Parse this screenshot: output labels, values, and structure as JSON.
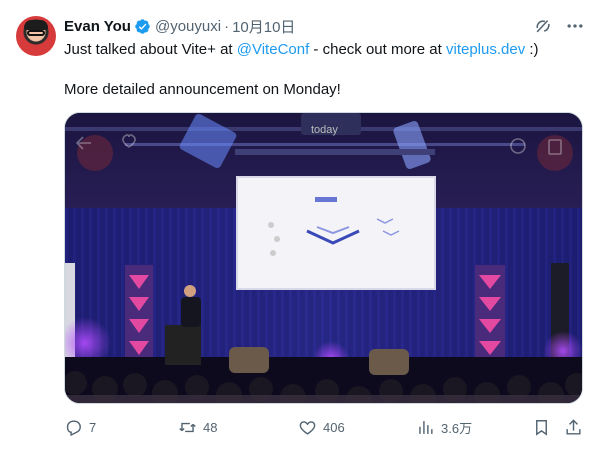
{
  "tweet": {
    "author": {
      "name": "Evan You",
      "handle": "@youyuxi",
      "separator": "·",
      "date": "10月10日",
      "verified_color": "#1d9bf0"
    },
    "text": {
      "line1_prefix": "Just talked about Vite+ at ",
      "mention": "@ViteConf",
      "line1_mid": " - check out more at ",
      "url": "viteplus.dev",
      "line1_suffix": " :)",
      "line2": "More detailed announcement on Monday!"
    },
    "media": {
      "banner_text": "today",
      "icons": [
        "back-icon",
        "like-icon",
        "share-icon",
        "info-icon",
        "trash-icon"
      ]
    },
    "actions": {
      "replies": "7",
      "retweets": "48",
      "likes": "406",
      "views": "3.6万"
    },
    "colors": {
      "link": "#1d9bf0",
      "muted": "#536471"
    },
    "top_icons": [
      "grok-icon",
      "more-icon"
    ]
  }
}
